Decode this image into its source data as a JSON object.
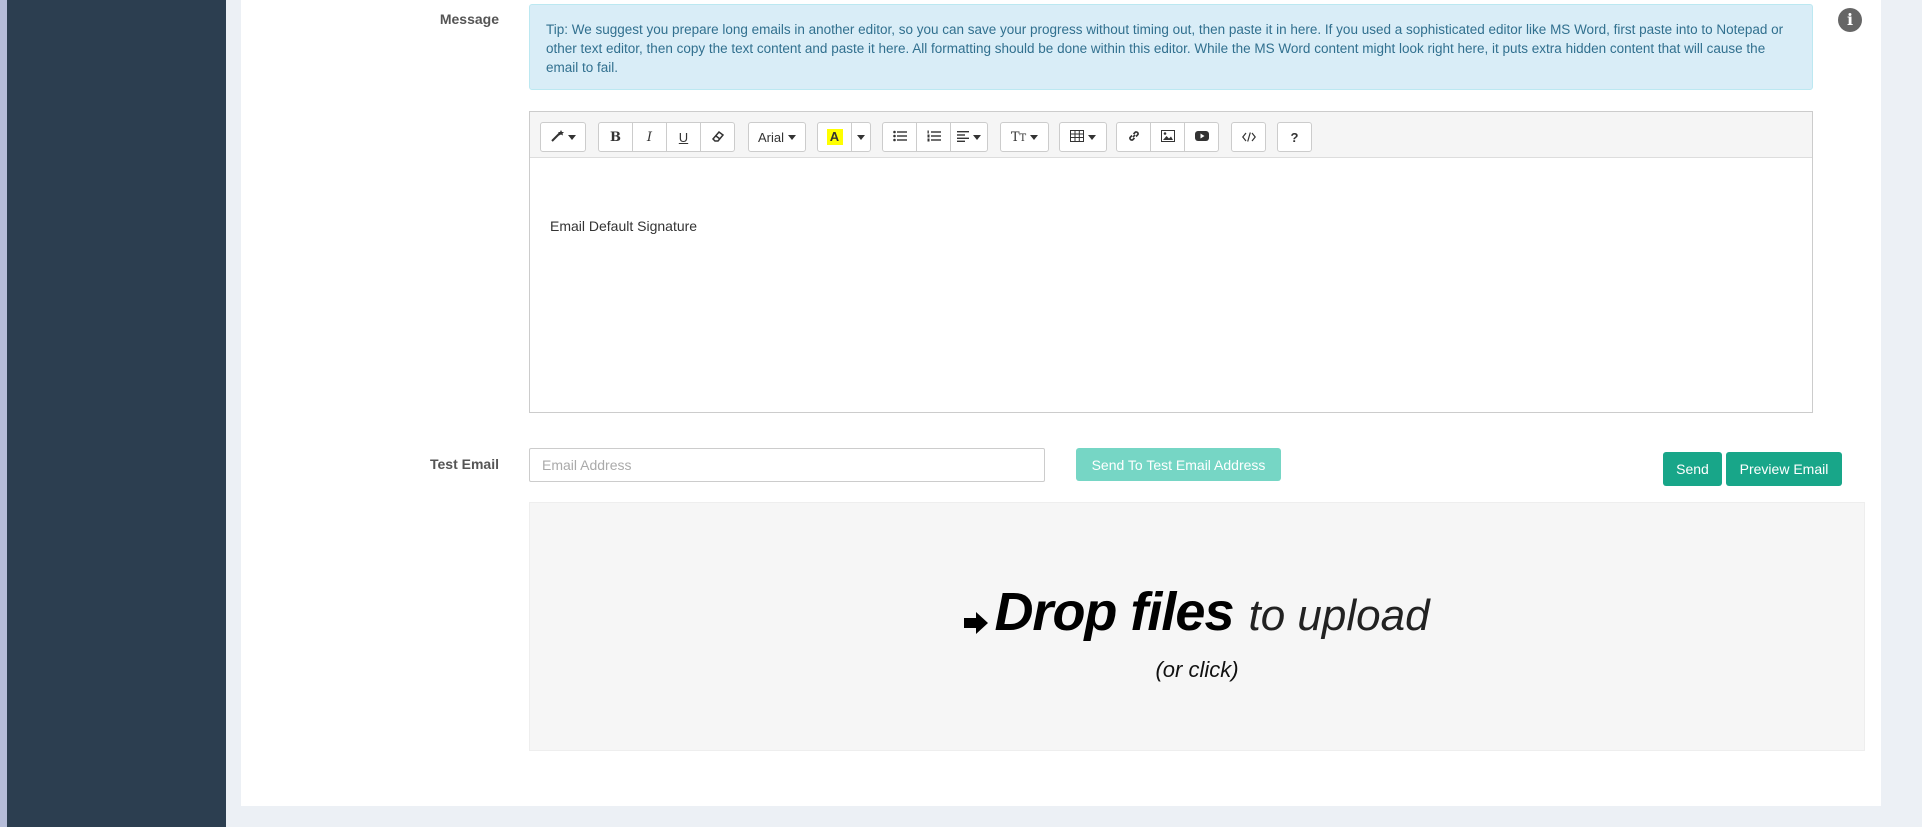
{
  "form": {
    "message_label": "Message",
    "test_email_label": "Test Email"
  },
  "tip": {
    "text": "Tip: We suggest you prepare long emails in another editor, so you can save your progress without timing out, then paste it in here. If you used a sophisticated editor like MS Word, first paste into to Notepad or other text editor, then copy the text content and paste it here. All formatting should be done within this editor. While the MS Word content might look right here, it puts extra hidden content that will cause the email to fail."
  },
  "editor": {
    "toolbar": {
      "bold": "B",
      "italic": "I",
      "underline": "U",
      "font_name": "Arial",
      "highlight": "A",
      "font_size": "T",
      "help": "?"
    },
    "content": "Email Default Signature"
  },
  "test_email": {
    "placeholder": "Email Address",
    "send_test_label": "Send To Test Email Address"
  },
  "actions": {
    "send_label": "Send",
    "preview_label": "Preview Email"
  },
  "dropzone": {
    "bold_text": "Drop files",
    "light_text": "to upload",
    "sub_text": "(or click)"
  },
  "colors": {
    "sidebar": "#2c3e50",
    "primary_button": "#18a689",
    "disabled_button": "#76d6c5",
    "tip_background": "#d9edf7",
    "tip_text": "#31708f"
  },
  "icons": [
    "info-icon",
    "magic-wand-icon",
    "eraser-icon",
    "unordered-list-icon",
    "ordered-list-icon",
    "align-icon",
    "table-icon",
    "link-icon",
    "image-icon",
    "video-icon",
    "code-icon",
    "arrow-right-icon"
  ]
}
